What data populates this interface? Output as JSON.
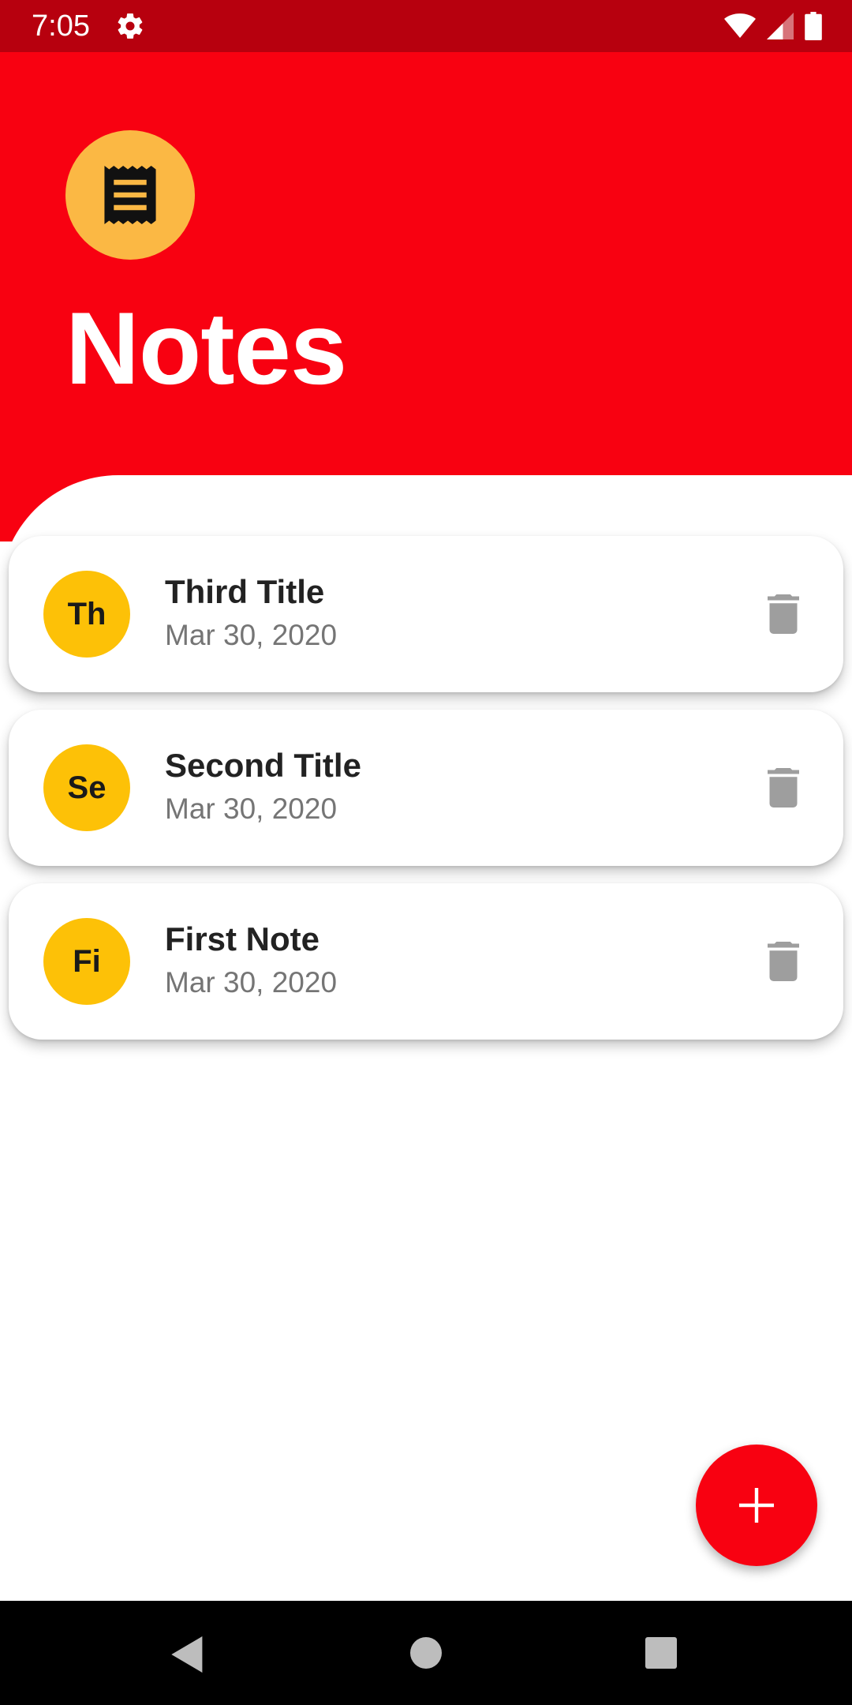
{
  "status_bar": {
    "time": "7:05",
    "icons": [
      "gear-icon",
      "wifi-icon",
      "signal-icon",
      "battery-icon"
    ]
  },
  "header": {
    "logo_icon": "receipt-icon",
    "title": "Notes"
  },
  "notes": [
    {
      "initials": "Th",
      "title": "Third Title",
      "date": "Mar 30, 2020"
    },
    {
      "initials": "Se",
      "title": "Second Title",
      "date": "Mar 30, 2020"
    },
    {
      "initials": "Fi",
      "title": "First Note",
      "date": "Mar 30, 2020"
    }
  ],
  "fab": {
    "icon": "plus-icon"
  },
  "nav_bar": {
    "icons": [
      "back-icon",
      "home-icon",
      "recents-icon"
    ]
  },
  "colors": {
    "status_bar": "#b7000e",
    "primary": "#f80111",
    "logo_badge": "#fbb844",
    "avatar": "#fdc107",
    "delete_icon": "#9e9e9e"
  }
}
